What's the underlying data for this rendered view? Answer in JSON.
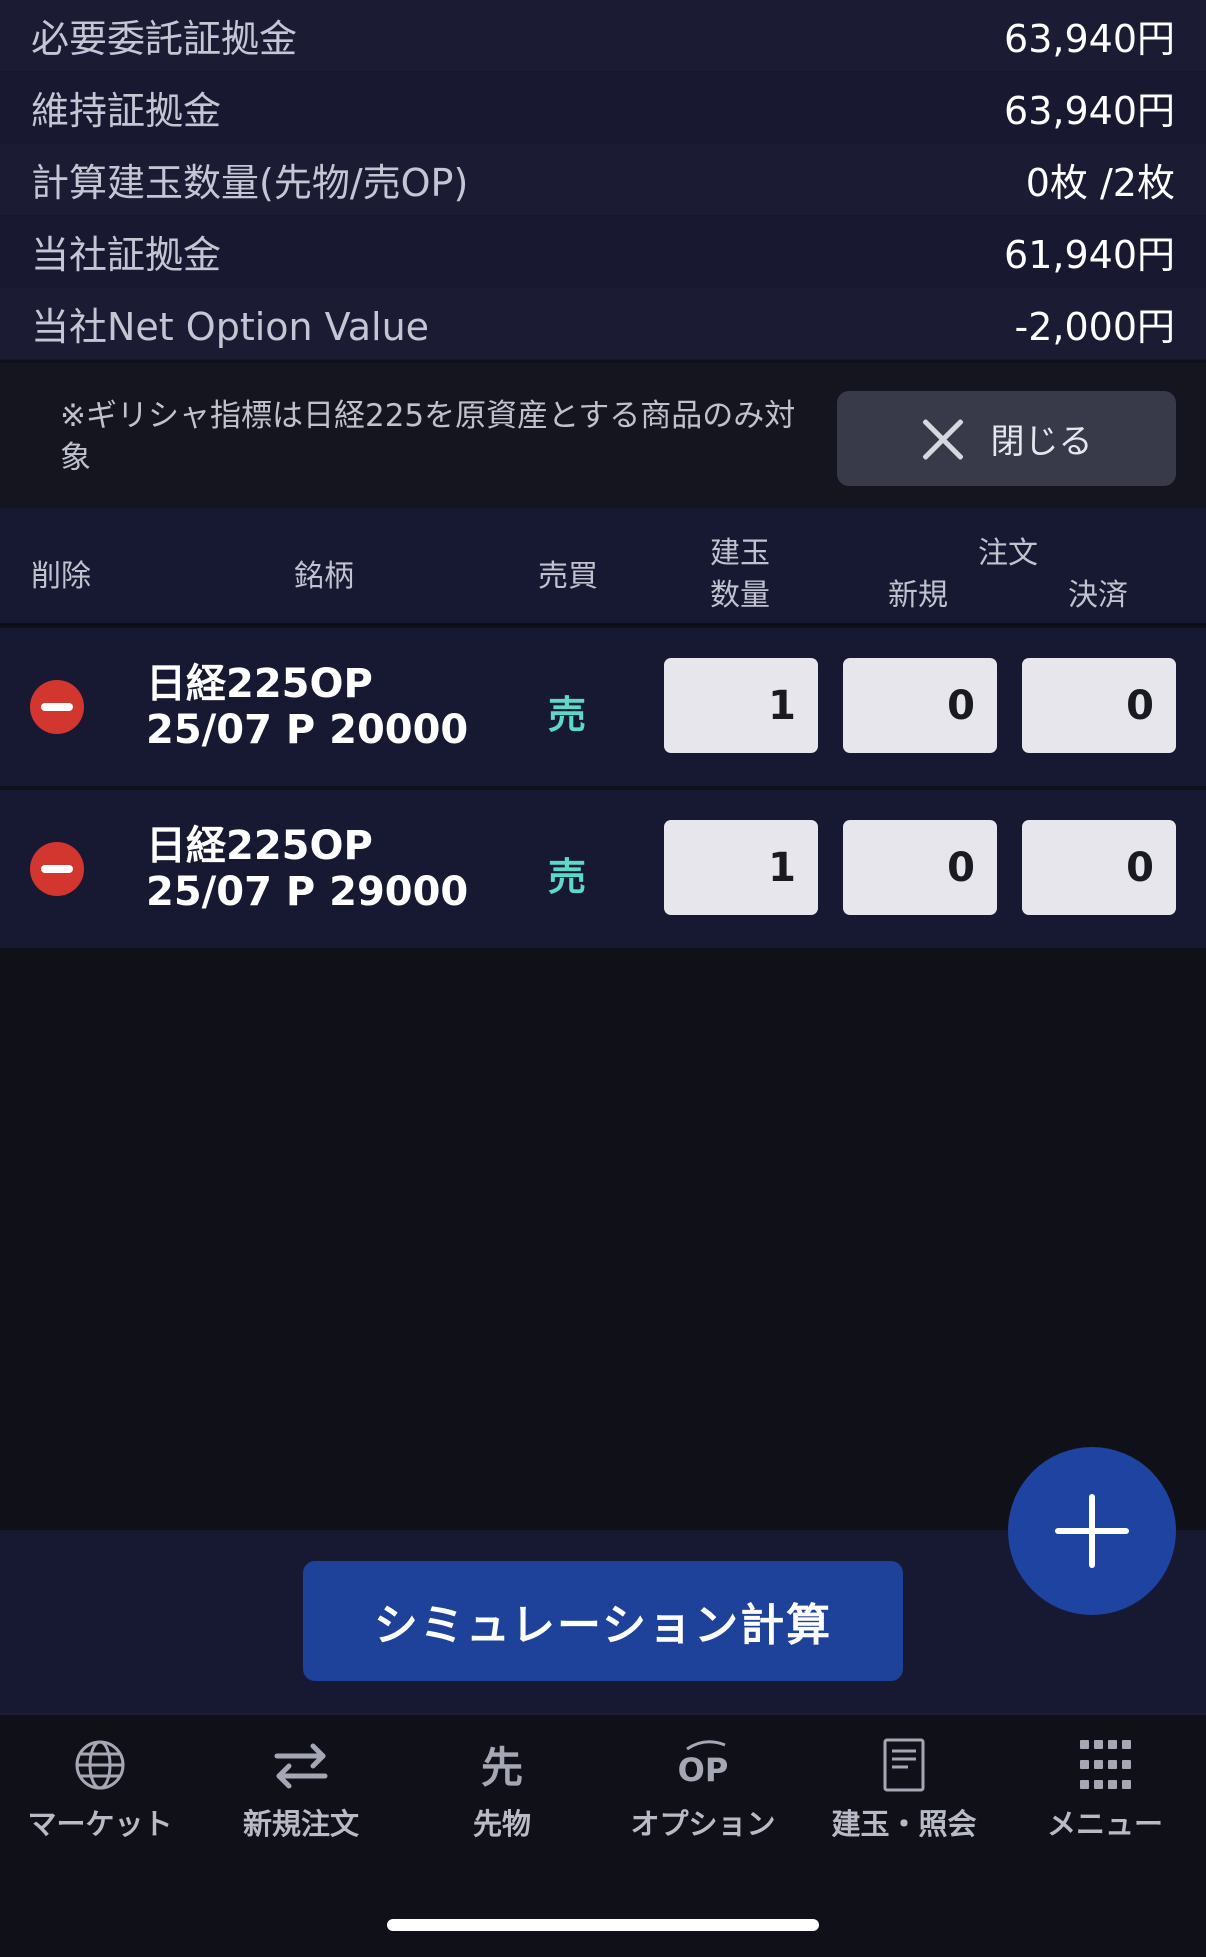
{
  "summary": [
    {
      "label": "必要委託証拠金",
      "value": "63,940円"
    },
    {
      "label": "維持証拠金",
      "value": "63,940円"
    },
    {
      "label": "計算建玉数量(先物/売OP)",
      "value": "0枚 /2枚"
    },
    {
      "label": "当社証拠金",
      "value": "61,940円"
    },
    {
      "label": "当社Net Option Value",
      "value": "-2,000円"
    }
  ],
  "note": {
    "text": "※ギリシャ指標は日経225を原資産とする商品のみ対象",
    "close_label": "閉じる"
  },
  "table": {
    "headers": {
      "delete": "削除",
      "instrument": "銘柄",
      "side": "売買",
      "position_line1": "建玉",
      "position_line2": "数量",
      "order": "注文",
      "new": "新規",
      "settle": "決済"
    },
    "rows": [
      {
        "name": "日経225OP",
        "contract": "25/07 P 20000",
        "side": "売",
        "position_qty": "1",
        "new_qty": "0",
        "settle_qty": "0"
      },
      {
        "name": "日経225OP",
        "contract": "25/07 P 29000",
        "side": "売",
        "position_qty": "1",
        "new_qty": "0",
        "settle_qty": "0"
      }
    ]
  },
  "simulate_label": "シミュレーション計算",
  "tabs": [
    {
      "label": "マーケット",
      "icon": "globe-icon"
    },
    {
      "label": "新規注文",
      "icon": "exchange-arrows-icon"
    },
    {
      "label": "先物",
      "icon": "futures-icon",
      "glyph": "先"
    },
    {
      "label": "オプション",
      "icon": "option-icon",
      "glyph": "OP"
    },
    {
      "label": "建玉・照会",
      "icon": "document-icon"
    },
    {
      "label": "メニュー",
      "icon": "grid-menu-icon"
    }
  ],
  "colors": {
    "accent": "#1e4199",
    "sell": "#5ed8c8",
    "delete": "#d2362f"
  }
}
